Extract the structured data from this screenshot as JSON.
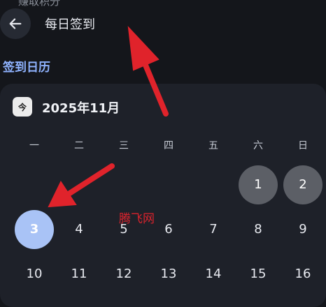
{
  "header": {
    "cut_text": "赚取积分",
    "title": "每日签到",
    "back_icon": "arrow-left-icon"
  },
  "section_title": "签到日历",
  "calendar": {
    "today_icon_label": "今",
    "month": "2025年11月",
    "weekdays": [
      "一",
      "二",
      "三",
      "四",
      "五",
      "六",
      "日"
    ],
    "days": [
      {
        "label": "1",
        "state": "checked"
      },
      {
        "label": "2",
        "state": "checked"
      },
      {
        "label": "3",
        "state": "selected"
      },
      {
        "label": "4",
        "state": "normal"
      },
      {
        "label": "5",
        "state": "normal"
      },
      {
        "label": "6",
        "state": "normal"
      },
      {
        "label": "7",
        "state": "normal"
      },
      {
        "label": "8",
        "state": "normal"
      },
      {
        "label": "9",
        "state": "normal"
      },
      {
        "label": "10",
        "state": "normal"
      },
      {
        "label": "11",
        "state": "normal"
      },
      {
        "label": "12",
        "state": "normal"
      },
      {
        "label": "13",
        "state": "normal"
      },
      {
        "label": "14",
        "state": "normal"
      },
      {
        "label": "15",
        "state": "normal"
      },
      {
        "label": "16",
        "state": "normal"
      }
    ]
  },
  "watermark": "腾飞网",
  "colors": {
    "accent": "#8fb3ff",
    "selected_day": "#a9c3f6",
    "checked_day": "#5c5f66",
    "annotation_arrow": "#e0232b"
  }
}
